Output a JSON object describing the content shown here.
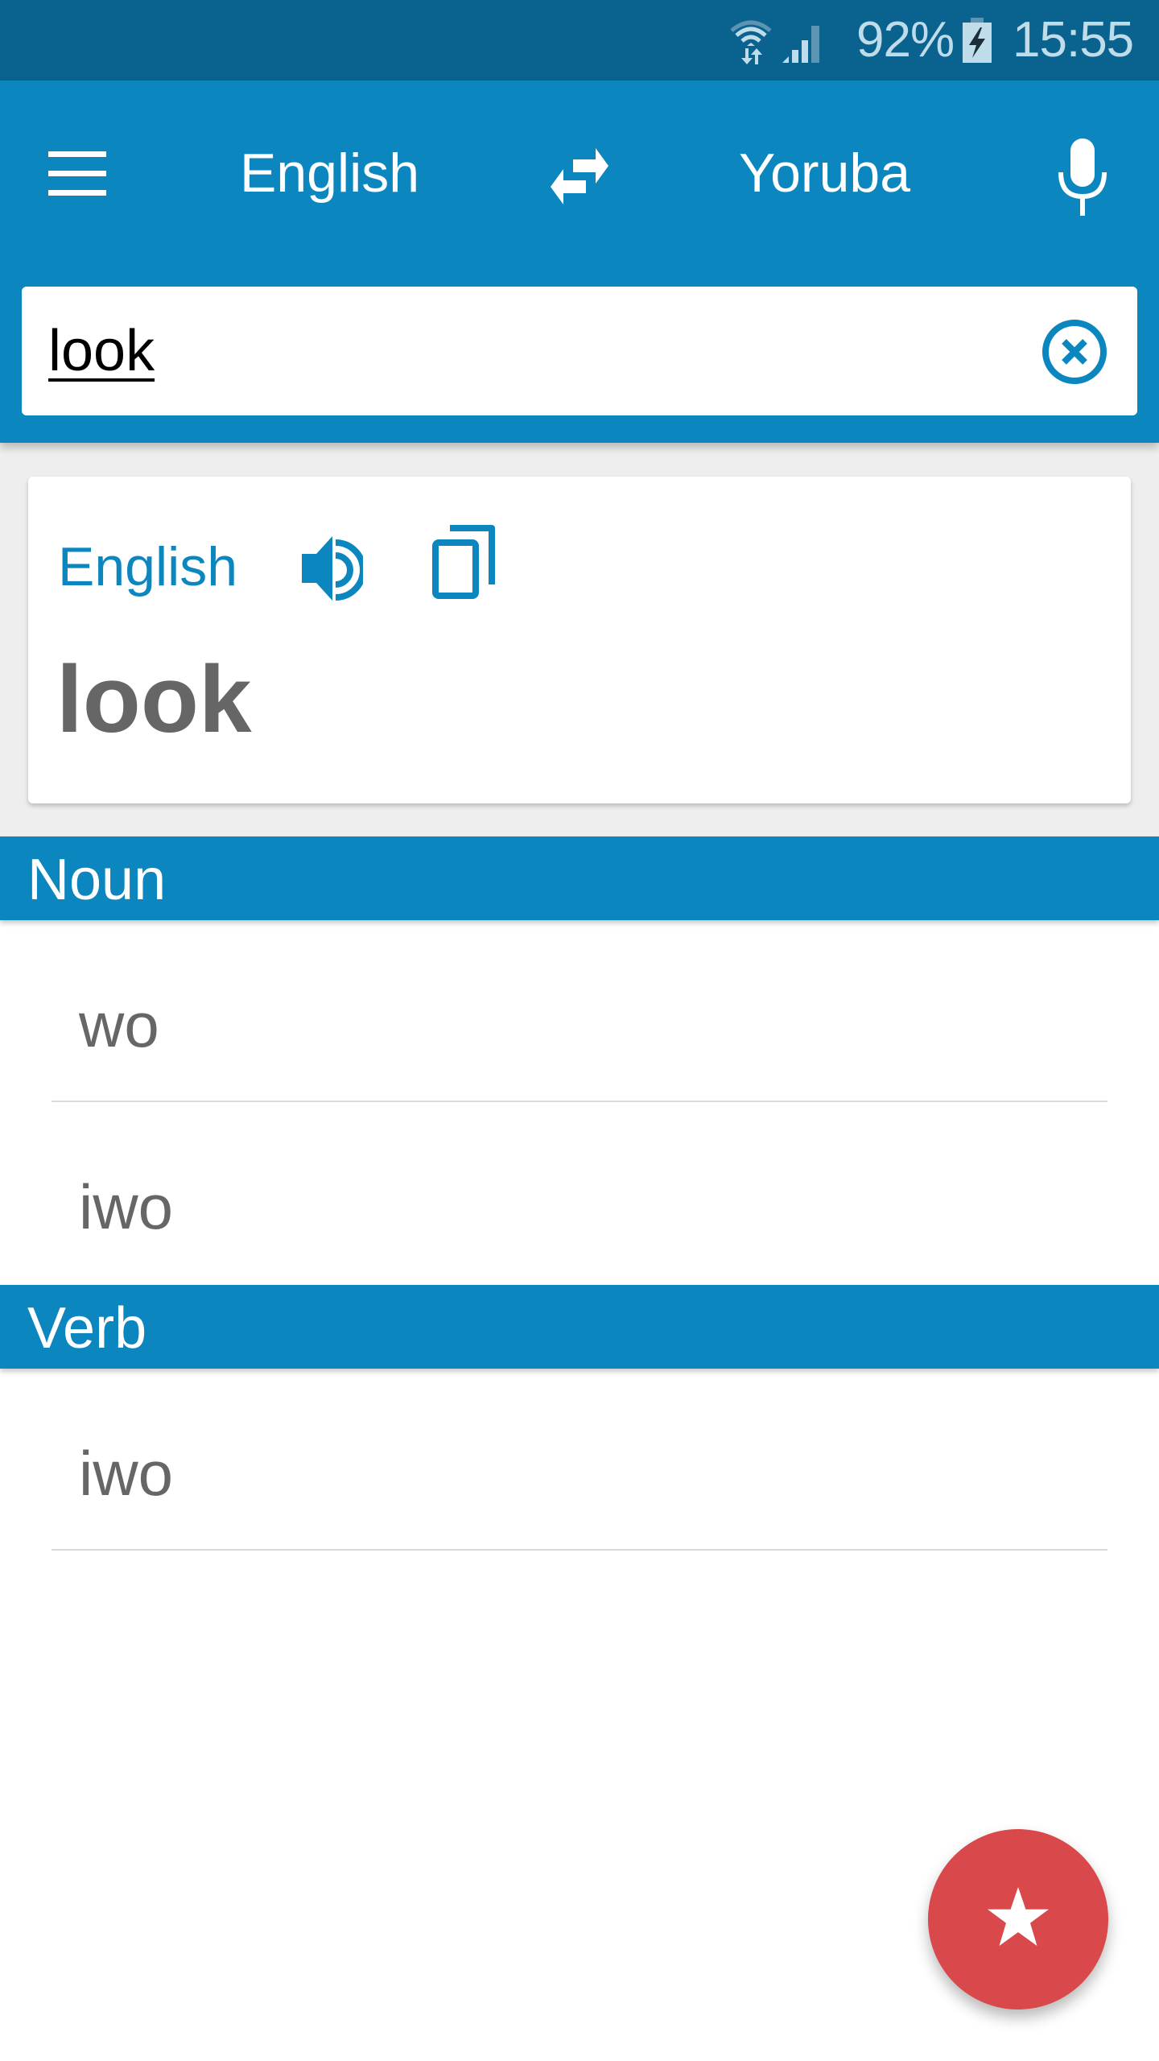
{
  "status_bar": {
    "wifi_icon": "wifi-data-icon",
    "signal_icon": "cell-signal-icon",
    "battery_percent": "92%",
    "battery_icon": "battery-charging-icon",
    "time": "15:55"
  },
  "app_bar": {
    "menu_icon": "hamburger-menu-icon",
    "source_language": "English",
    "swap_icon": "swap-languages-icon",
    "target_language": "Yoruba",
    "mic_icon": "microphone-icon"
  },
  "search": {
    "value": "look",
    "placeholder": "",
    "clear_icon": "clear-circle-icon"
  },
  "source_card": {
    "language": "English",
    "speak_icon": "speaker-icon",
    "copy_icon": "copy-icon",
    "word": "look"
  },
  "sections": [
    {
      "part_of_speech": "Noun",
      "translations": [
        "wo",
        "iwo"
      ]
    },
    {
      "part_of_speech": "Verb",
      "translations": [
        "iwo"
      ]
    }
  ],
  "fab": {
    "icon": "star-favorite-icon"
  },
  "colors": {
    "status_bar": "#0A628F",
    "primary": "#0B86BF",
    "background": "#EEEEEE",
    "text_gray": "#666666",
    "fab": "#D9484A",
    "divider": "#DADADA"
  }
}
